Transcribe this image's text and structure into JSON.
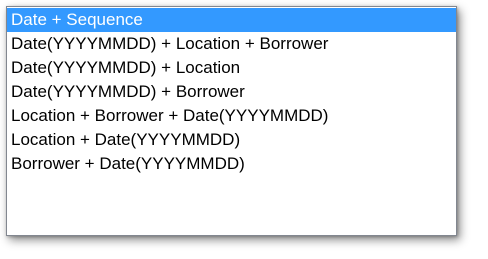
{
  "dropdown": {
    "selected_index": 0,
    "items": [
      {
        "label": "Date + Sequence"
      },
      {
        "label": "Date(YYYYMMDD) + Location + Borrower"
      },
      {
        "label": "Date(YYYYMMDD) + Location"
      },
      {
        "label": "Date(YYYYMMDD) + Borrower"
      },
      {
        "label": "Location + Borrower + Date(YYYYMMDD)"
      },
      {
        "label": "Location + Date(YYYYMMDD)"
      },
      {
        "label": "Borrower + Date(YYYYMMDD)"
      }
    ]
  },
  "colors": {
    "selection_background": "#3399ff",
    "selection_text": "#ffffff",
    "border": "#828790"
  }
}
